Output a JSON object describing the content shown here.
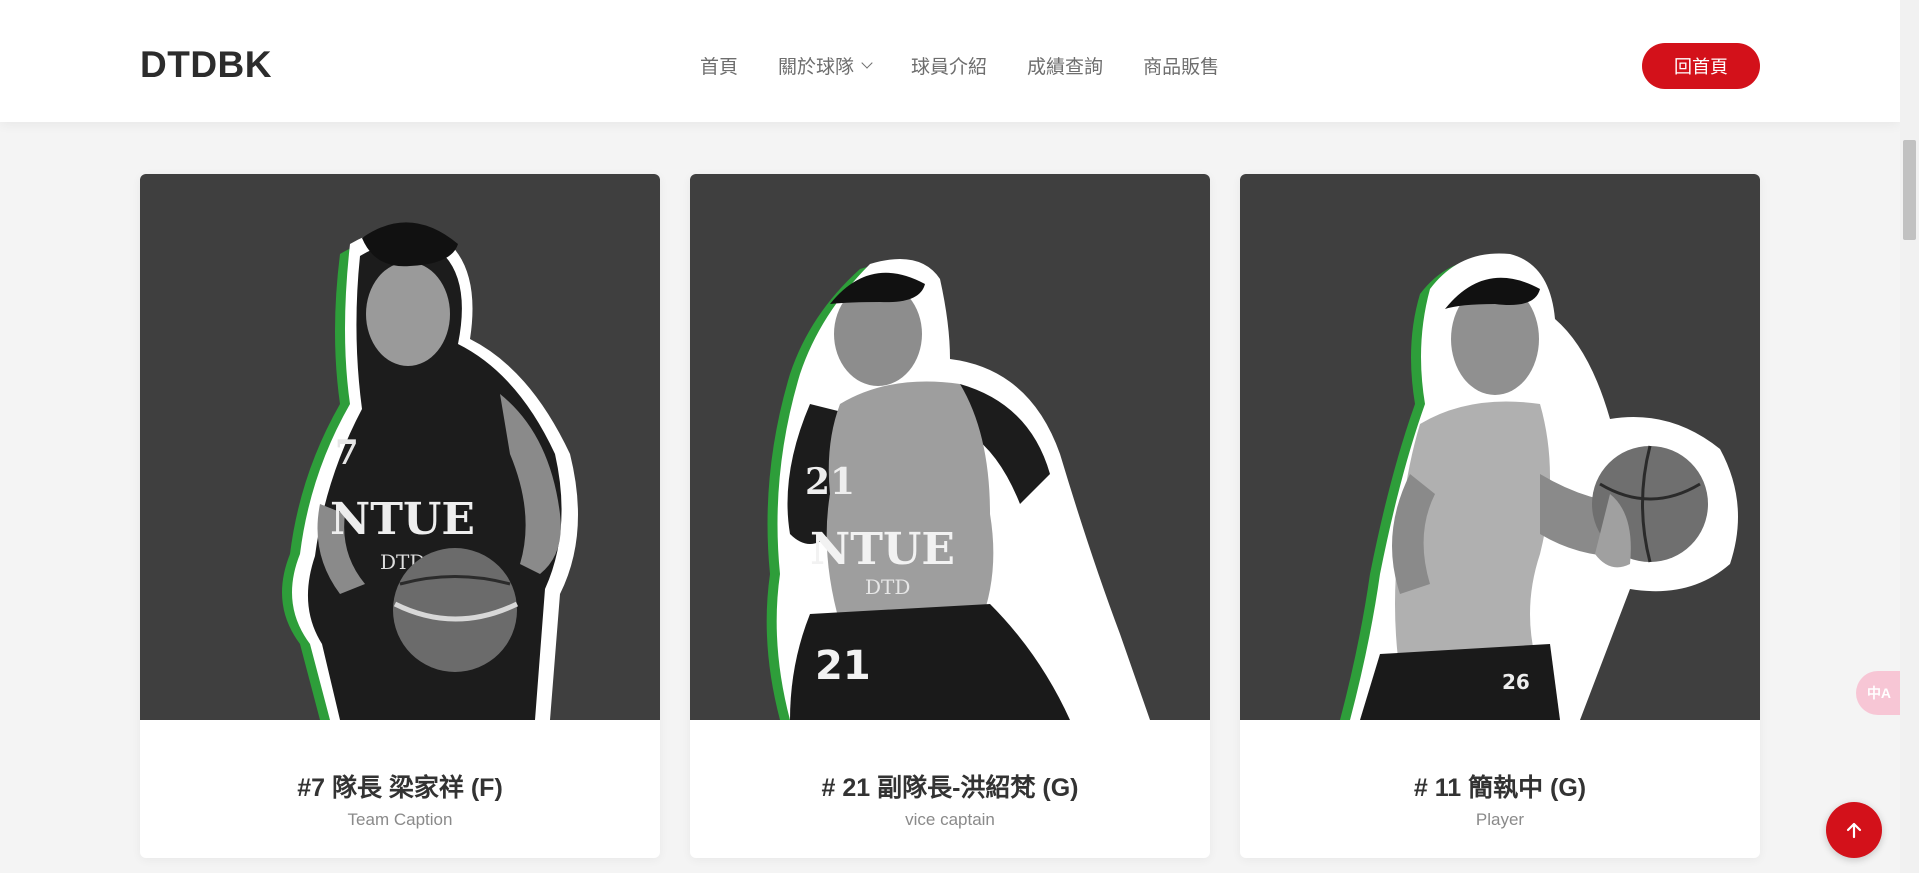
{
  "header": {
    "logo": "DTDBK",
    "nav": [
      {
        "label": "首頁"
      },
      {
        "label": "關於球隊"
      },
      {
        "label": "球員介紹"
      },
      {
        "label": "成績查詢"
      },
      {
        "label": "商品販售"
      }
    ],
    "home_button": "回首頁"
  },
  "players": [
    {
      "title": "#7 隊長 梁家祥 (F)",
      "subtitle": "Team Caption",
      "jersey": "7"
    },
    {
      "title": "# 21 副隊長-洪紹梵 (G)",
      "subtitle": "vice captain",
      "jersey": "21"
    },
    {
      "title": "# 11 簡執中 (G)",
      "subtitle": "Player",
      "jersey": "26"
    }
  ],
  "translate_widget": {
    "label": "中A"
  },
  "colors": {
    "accent": "#d3111a",
    "card_bg": "#3f3f3f",
    "outline_green": "#2e9e3a"
  },
  "icons": {
    "back_to_top": "arrow-up-icon",
    "dropdown": "chevron-down-icon"
  }
}
